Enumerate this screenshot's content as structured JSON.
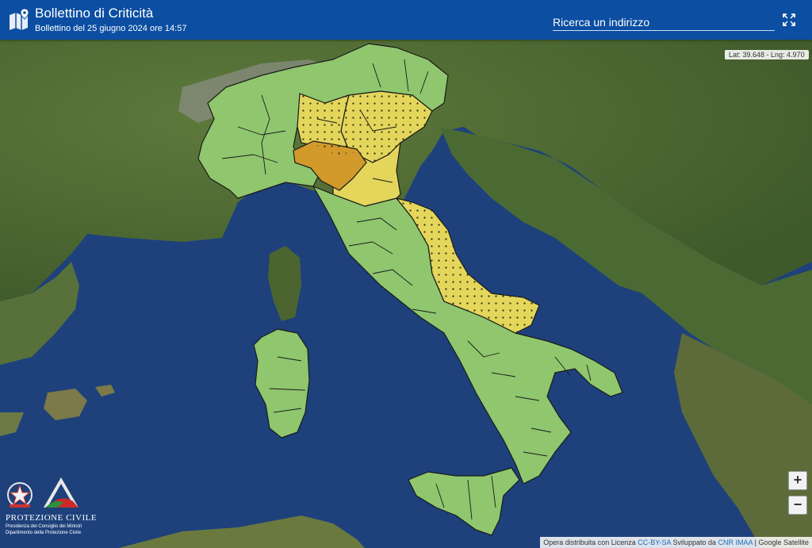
{
  "header": {
    "title": "Bollettino di Criticità",
    "subtitle": "Bollettino del 25 giugno 2024 ore 14:57"
  },
  "search": {
    "placeholder": "Ricerca un indirizzo"
  },
  "coords": "Lat: 39.648 - Lng: 4.970",
  "zoom": {
    "in": "+",
    "out": "−"
  },
  "attribution": {
    "prefix": "Opera distribuita con Licenza",
    "license": "CC-BY-SA",
    "mid": "Sviluppato da",
    "dev": "CNR IMAA",
    "sep": "|",
    "tiles": "Google Satellite"
  },
  "logo": {
    "name": "PROTEZIONE CIVILE",
    "line1": "Presidenza del Consiglio dei Ministri",
    "line2": "Dipartimento della Protezione Civile"
  },
  "colors": {
    "header": "#0b4ea2",
    "sea": "#1d3f7a",
    "green_alert": "#8fc66e",
    "yellow_alert": "#e3d65b",
    "orange_alert": "#d19a2a"
  },
  "icons": [
    "map-icon",
    "fullscreen-icon",
    "republic-emblem-icon",
    "protezione-civile-logo-icon"
  ]
}
